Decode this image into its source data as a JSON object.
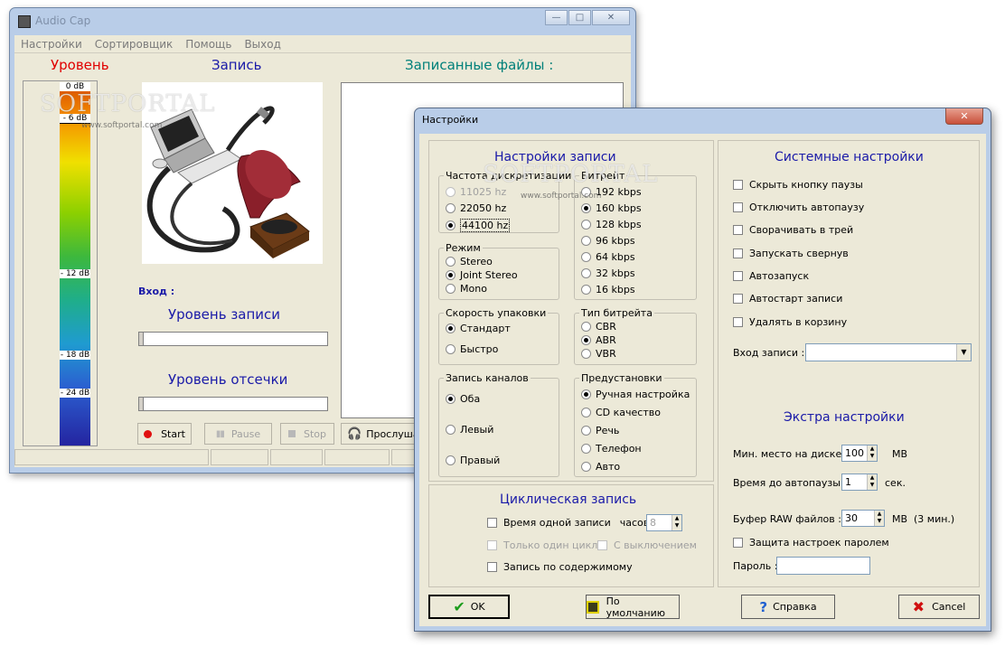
{
  "main": {
    "title": "Audio Cap",
    "menu": [
      "Настройки",
      "Сортировщик",
      "Помощь",
      "Выход"
    ],
    "label_level": "Уровень",
    "label_record": "Запись",
    "label_files": "Записанные файлы :",
    "meter_ticks": [
      "0 dB",
      "- 6 dB",
      "- 12 dB",
      "- 18 dB",
      "- 24 dB"
    ],
    "label_input": "Вход :",
    "label_record_level": "Уровень записи",
    "label_cut_level": "Уровень отсечки",
    "btn_start": "Start",
    "btn_pause": "Pause",
    "btn_stop": "Stop",
    "btn_listen": "Прослуша"
  },
  "watermark": {
    "text": "SOFTPORTAL",
    "url": "www.softportal.com"
  },
  "settings": {
    "title": "Настройки",
    "record_settings": {
      "title": "Настройки записи",
      "sample_rate": {
        "title": "Частота дискретизации",
        "options": [
          "11025 hz",
          "22050 hz",
          "44100 hz"
        ],
        "selected": "44100 hz"
      },
      "bitrate": {
        "title": "Битрейт",
        "options": [
          "192 kbps",
          "160 kbps",
          "128 kbps",
          "96 kbps",
          "64 kbps",
          "32 kbps",
          "16 kbps"
        ],
        "selected": "160 kbps"
      },
      "mode": {
        "title": "Режим",
        "options": [
          "Stereo",
          "Joint Stereo",
          "Mono"
        ],
        "selected": "Joint Stereo"
      },
      "pack_speed": {
        "title": "Скорость упаковки",
        "options": [
          "Стандарт",
          "Быстро"
        ],
        "selected": "Стандарт"
      },
      "bitrate_type": {
        "title": "Тип битрейта",
        "options": [
          "CBR",
          "ABR",
          "VBR"
        ],
        "selected": "ABR"
      },
      "channels": {
        "title": "Запись каналов",
        "options": [
          "Оба",
          "Левый",
          "Правый"
        ],
        "selected": "Оба"
      },
      "presets": {
        "title": "Предустановки",
        "options": [
          "Ручная настройка",
          "CD качество",
          "Речь",
          "Телефон",
          "Авто"
        ],
        "selected": "Ручная настройка"
      }
    },
    "cyclic": {
      "title": "Циклическая запись",
      "one_record_time": "Время одной записи",
      "hours": "часов",
      "hours_value": "8",
      "only_one_cycle": "Только один цикл",
      "with_shutdown": "С выключением",
      "by_content": "Запись по содержимому"
    },
    "system": {
      "title": "Системные настройки",
      "checks": [
        "Скрыть кнопку паузы",
        "Отключить автопаузу",
        "Сворачивать в трей",
        "Запускать свернув",
        "Автозапуск",
        "Автостарт записи",
        "Удалять в корзину"
      ],
      "input_label": "Вход записи :",
      "input_value": ""
    },
    "extra": {
      "title": "Экстра настройки",
      "min_disk_label": "Мин. место на диске :",
      "min_disk_value": "100",
      "min_disk_unit": "MB",
      "autopause_label": "Время до автопаузы :",
      "autopause_value": "1",
      "autopause_unit": "сек.",
      "raw_label": "Буфер RAW файлов :",
      "raw_value": "30",
      "raw_unit": "MB",
      "raw_note": "(3 мин.)",
      "protect_label": "Защита настроек паролем",
      "password_label": "Пароль :",
      "password_value": ""
    },
    "buttons": {
      "ok": "OK",
      "default": "По умолчанию",
      "help": "Справка",
      "cancel": "Cancel"
    }
  }
}
